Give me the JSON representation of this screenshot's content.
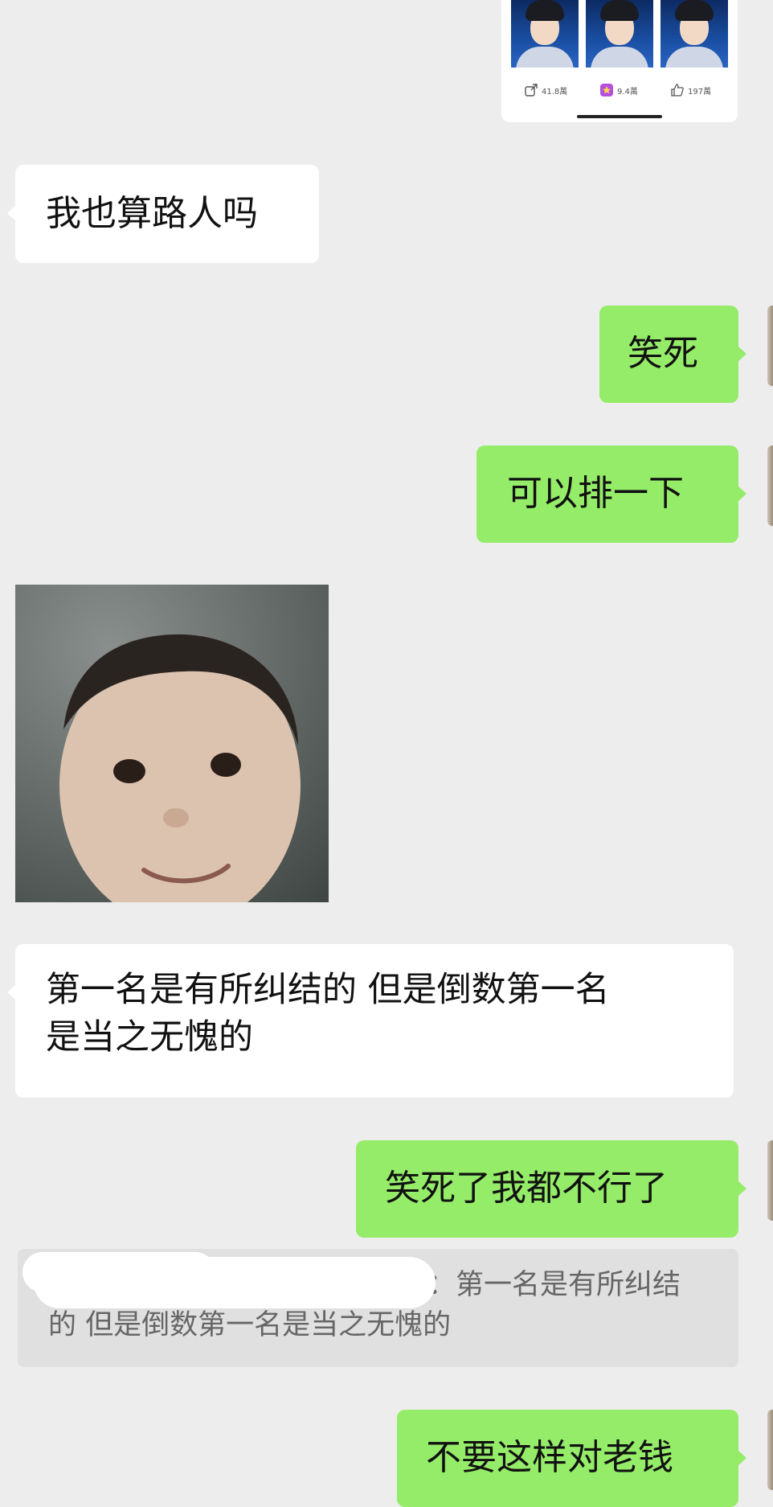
{
  "shared_card": {
    "stats": [
      {
        "icon": "share-icon",
        "value": "41.8萬"
      },
      {
        "icon": "star-badge-icon",
        "value": "9.4萬"
      },
      {
        "icon": "thumbs-up-icon",
        "value": "197萬"
      }
    ]
  },
  "messages": [
    {
      "side": "in",
      "text": "我也算路人吗"
    },
    {
      "side": "out",
      "text": "笑死"
    },
    {
      "side": "out",
      "text": "可以排一下"
    },
    {
      "side": "in",
      "type": "sticker",
      "icon": "smiling-baby-face-sticker"
    },
    {
      "side": "in",
      "line1": "第一名是有所纠结的 但是倒数第一名",
      "line2": "是当之无愧的"
    },
    {
      "side": "out",
      "text": "笑死了我都不行了"
    },
    {
      "side": "out",
      "text": "不要这样对老钱"
    }
  ],
  "quote": {
    "line1": "：第一名是有所纠结",
    "line2": "的 但是倒数第一名是当之无愧的"
  },
  "colors": {
    "background": "#ededed",
    "incoming_bubble": "#ffffff",
    "outgoing_bubble": "#95ec69",
    "quote_background": "#e0e0e0"
  }
}
